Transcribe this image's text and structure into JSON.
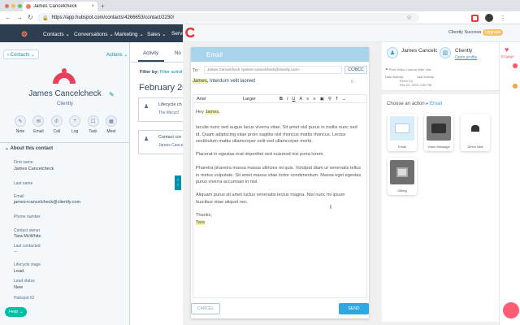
{
  "browser": {
    "tab_title": "James Cancelcheck",
    "tab_close": "×",
    "new_tab": "+",
    "url": "https://app.hubspot.com/contacts/4266653/contact/2230/",
    "nav_back": "←",
    "nav_forward": "→",
    "nav_reload": "↻",
    "star": "☆",
    "menu": "⋮",
    "dot_colors": [
      "#ed6a5e",
      "#f5bf4f",
      "#61c554"
    ]
  },
  "hubspot_nav": {
    "logo": "⚙",
    "items": [
      "Contacts ⌄",
      "Conversations ⌄",
      "Marketing ⌄",
      "Sales ⌄",
      "Servi"
    ],
    "bg_color": "#2d3e50"
  },
  "contact": {
    "back_link": "‹ Contacts ⌄",
    "actions": "Actions ⌄",
    "name": "James Cancelcheck",
    "company": "Cliently",
    "pencil": "✎",
    "action_buttons": [
      {
        "icon": "✎",
        "label": "Note"
      },
      {
        "icon": "✉",
        "label": "Email"
      },
      {
        "icon": "✆",
        "label": "Call"
      },
      {
        "icon": "+",
        "label": "Log"
      },
      {
        "icon": "☐",
        "label": "Task"
      },
      {
        "icon": "▦",
        "label": "Meet"
      }
    ],
    "about_heading": "About this contact",
    "fields": [
      {
        "label": "First name",
        "value": "James Cancelcheck"
      },
      {
        "label": "Last name",
        "value": ""
      },
      {
        "label": "Email",
        "value": "james+cancelcheck@cliently.com"
      },
      {
        "label": "Phone number",
        "value": ""
      },
      {
        "label": "Contact owner",
        "value": "Tara McWhite"
      },
      {
        "label": "Last contacted",
        "value": "--"
      },
      {
        "label": "Lifecycle stage",
        "value": "Lead"
      },
      {
        "label": "Lead status",
        "value": "New"
      },
      {
        "label": "Hubspot ID",
        "value": ""
      }
    ],
    "help_button": "Help ⌄"
  },
  "activity": {
    "tabs": [
      "Activity",
      "No"
    ],
    "filter_label": "Filter by:",
    "filter_value": "Filter activit",
    "month": "February 20",
    "cards": [
      {
        "icon": "♟",
        "title": "Lifecycle ch",
        "sub": "The lifecycl"
      },
      {
        "icon": "♟",
        "title": "Contact cre",
        "sub": "James Cancel"
      }
    ],
    "collapse": "›"
  },
  "overlay": {
    "hint": "Cliently Success",
    "badge": "Upgrade"
  },
  "composer": {
    "title": "Email",
    "to_label": "To:",
    "to_value": "James Cancelcheck <james+cancelcheck@cliently.com>",
    "ccbcc": "CC/BCC",
    "subject_name": "James,",
    "subject_rest": " Interdum velit laoreet",
    "subject_counter": "0",
    "toolbar": {
      "font": "Arial",
      "size": "Larger",
      "bold": "B",
      "italic": "I",
      "underline": "U",
      "color": "A",
      "list1": "≡",
      "list2": "≡",
      "image": "▣",
      "link": "⚲",
      "clear": "T",
      "more": "⌄"
    },
    "greeting_pre": "Hey ",
    "greeting_name": "James",
    "greeting_post": ",",
    "para1": "Iaculis nunc sed augue lacus viverra vitae. Sit amet nisl purus in mollis nunc sed id. Quam adipiscing vitae proin sagittis nisl rhoncus mattis rhoncus. Lectus vestibulum mattis ullamcorper velit sed ullamcorper morbi.",
    "para2": "Placerat in egestas erat imperdiet sed euismod nisi porta lorem.",
    "para3": "Pharetra pharetra massa massa ultricies mi quis. Volutpat diam ut venenatis tellus in metus vulputate. Sit amet massa vitae tortor condimentum. Massa eget egestas purus viverra accumsan in nisl.",
    "para4": "Aliquam purus sit amet luctus venenatis lectus magna. Nisl nunc mi ipsum faucibus vitae aliquet nec.",
    "signoff": "Thanks,",
    "signature": "Tara",
    "cancel": "CANCEL",
    "send": "SEND",
    "header_color": "#a8d4ec",
    "send_color": "#2ea8e0"
  },
  "right_panel": {
    "person1_name": "James Cancelc",
    "person2_name": "Cliently",
    "person2_link": "Open profile",
    "meta_line": "⚑ Print Video   Custom Web Vlia",
    "meta_col1": "Date Activity:",
    "meta_col2": "Last Activity:",
    "meta_val1": "Kevin Co",
    "meta_val2": "Feb 22, 2019 2:00 PM",
    "choose_pre": "Choose an action ",
    "choose_action": "▸ Email",
    "tiles": [
      {
        "label": "Email",
        "icon": "✉",
        "bg": "#d8eef8"
      },
      {
        "label": "Video Message",
        "icon": "▶",
        "bg": "#555555"
      },
      {
        "label": "Direct Mail",
        "icon": "✉",
        "bg": "#ffffff"
      },
      {
        "label": "Gifting",
        "icon": "🎁",
        "bg": "#6f6f6f"
      }
    ]
  },
  "far_right": {
    "icon": "♥",
    "label": "Engage"
  }
}
